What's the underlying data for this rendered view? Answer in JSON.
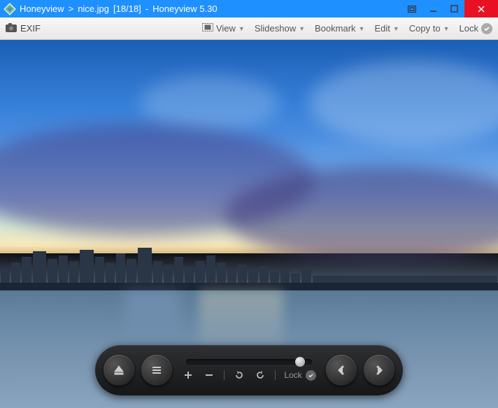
{
  "titlebar": {
    "app_name": "Honeyview",
    "separator": ">",
    "file_name": "nice.jpg",
    "index": "[18/18]",
    "dash": "-",
    "app_title": "Honeyview 5.30"
  },
  "toolbar": {
    "exif": "EXIF",
    "view": "View",
    "slideshow": "Slideshow",
    "bookmark": "Bookmark",
    "edit": "Edit",
    "copy_to": "Copy to",
    "lock": "Lock"
  },
  "controls": {
    "lock": "Lock"
  }
}
